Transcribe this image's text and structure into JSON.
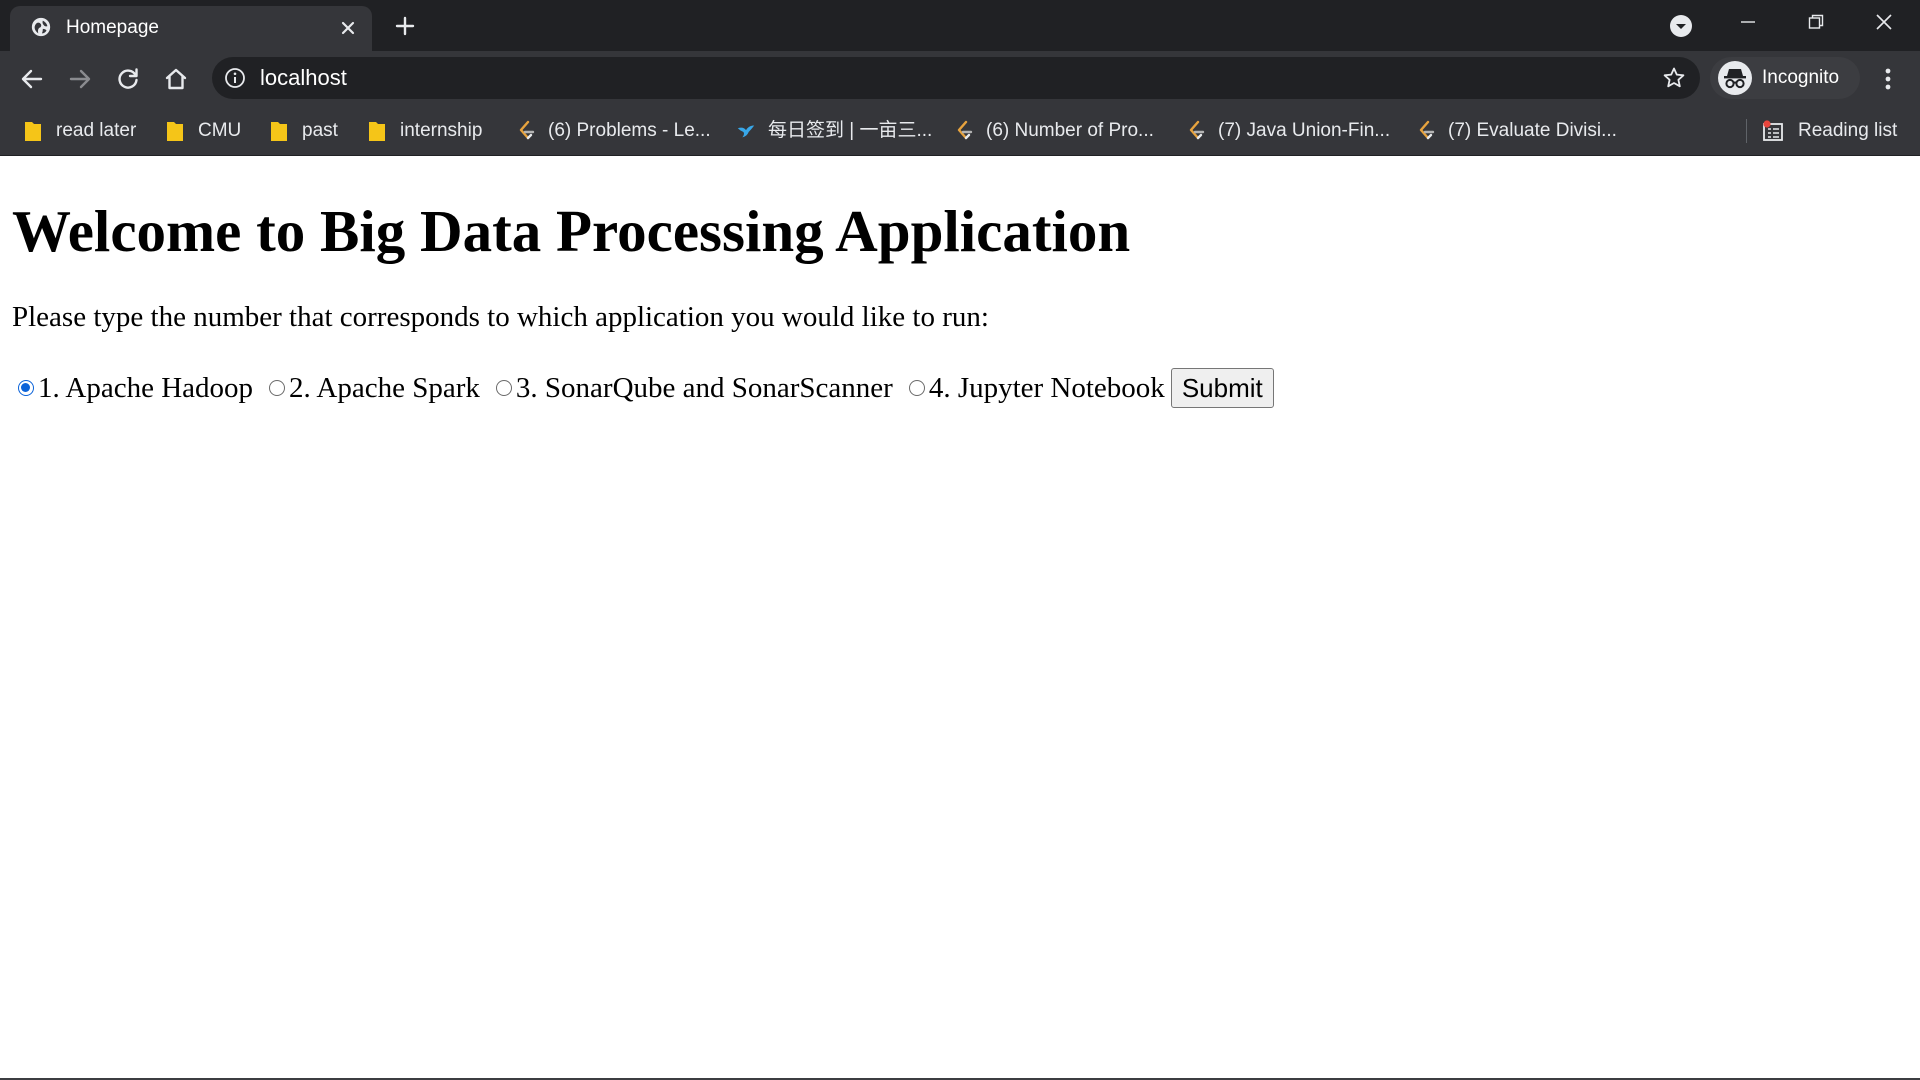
{
  "browser": {
    "tab": {
      "title": "Homepage",
      "favicon": "globe-icon",
      "close_icon": "close-icon"
    },
    "new_tab_icon": "plus-icon",
    "window_controls": [
      "minimize-icon",
      "restore-icon",
      "close-icon"
    ],
    "toolbar": {
      "back_icon": "arrow-left-icon",
      "forward_icon": "arrow-right-icon",
      "reload_icon": "reload-icon",
      "home_icon": "home-icon",
      "url": "localhost",
      "profile_label": "Incognito",
      "menu_icon": "kebab-menu-icon"
    },
    "bookmarks": [
      {
        "label": "read later",
        "icon": "folder-icon"
      },
      {
        "label": "CMU",
        "icon": "folder-icon"
      },
      {
        "label": "past",
        "icon": "folder-icon"
      },
      {
        "label": "internship",
        "icon": "folder-icon"
      },
      {
        "label": "(6) Problems - Le...",
        "icon": "leetcode-icon"
      },
      {
        "label": "每日签到 | 一亩三...",
        "icon": "bird-icon"
      },
      {
        "label": "(6) Number of Pro...",
        "icon": "leetcode-icon"
      },
      {
        "label": "(7) Java Union-Fin...",
        "icon": "leetcode-icon"
      },
      {
        "label": "(7) Evaluate Divisi...",
        "icon": "leetcode-icon"
      }
    ],
    "reading_list_label": "Reading list"
  },
  "page": {
    "heading": "Welcome to Big Data Processing Application",
    "intro": "Please type the number that corresponds to which application you would like to run:",
    "options": [
      {
        "label": "1. Apache Hadoop",
        "checked": true
      },
      {
        "label": "2. Apache Spark",
        "checked": false
      },
      {
        "label": "3. SonarQube and SonarScanner",
        "checked": false
      },
      {
        "label": "4. Jupyter Notebook",
        "checked": false
      }
    ],
    "submit_label": "Submit"
  },
  "colors": {
    "titlebar": "#202124",
    "toolbar": "#35363a",
    "omnibox": "#202124",
    "folder": "#f5c518",
    "radio_accent": "#0b63d9"
  }
}
